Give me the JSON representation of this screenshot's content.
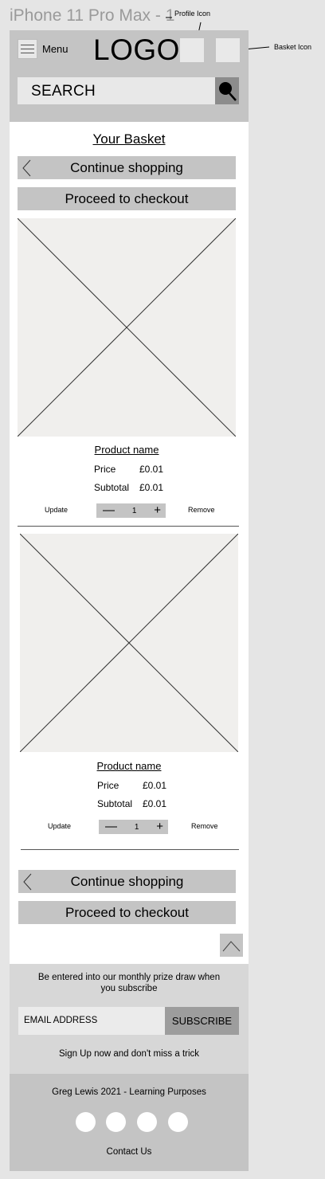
{
  "frame": {
    "title": "iPhone 11 Pro Max - 1"
  },
  "annotations": {
    "profile_icon": "Profile Icon",
    "basket_icon": "Basket Icon"
  },
  "header": {
    "menu_label": "Menu",
    "logo": "LOGO",
    "search_placeholder": "SEARCH",
    "icons": [
      "hamburger-icon",
      "profile-icon",
      "basket-icon",
      "search-icon"
    ]
  },
  "basket": {
    "title": "Your Basket",
    "continue_label": "Continue shopping",
    "checkout_label": "Proceed to checkout",
    "items": [
      {
        "name": "Product name",
        "price_label": "Price",
        "price": "£0.01",
        "subtotal_label": "Subtotal",
        "subtotal": "£0.01",
        "update_label": "Update",
        "quantity": "1",
        "remove_label": "Remove"
      },
      {
        "name": "Product name",
        "price_label": "Price",
        "price": "£0.01",
        "subtotal_label": "Subtotal",
        "subtotal": "£0.01",
        "update_label": "Update",
        "quantity": "1",
        "remove_label": "Remove"
      }
    ]
  },
  "newsletter": {
    "text": "Be entered into our monthly prize draw when you subscribe",
    "email_placeholder": "EMAIL ADDRESS",
    "subscribe_label": "SUBSCRIBE",
    "signup_text": "Sign Up now and don't miss a trick"
  },
  "footer": {
    "credits": "Greg Lewis 2021 - Learning Purposes",
    "contact": "Contact Us",
    "social_icons": [
      "social-icon-1",
      "social-icon-2",
      "social-icon-3",
      "social-icon-4"
    ]
  },
  "colors": {
    "header_bg": "#c4c4c4",
    "page_bg": "#e5e5e5",
    "button_bg": "#c4c4c4",
    "subscribe_bg": "#9d9d9d"
  }
}
